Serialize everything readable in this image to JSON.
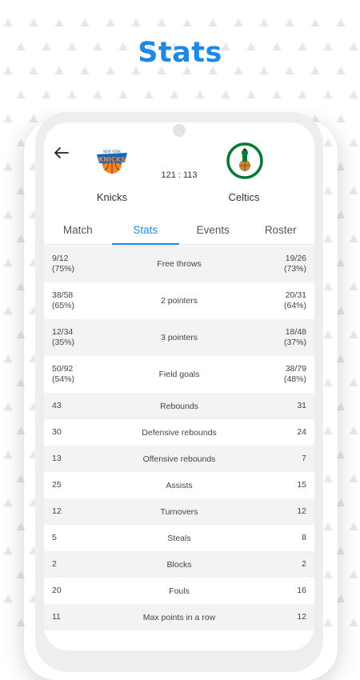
{
  "page": {
    "heading": "Stats"
  },
  "match": {
    "home": {
      "name": "Knicks",
      "logo_text": "NEW YORK KNICKS"
    },
    "away": {
      "name": "Celtics",
      "logo_text": "BOSTON CELTICS"
    },
    "score": "121 : 113"
  },
  "tabs": [
    {
      "label": "Match"
    },
    {
      "label": "Stats"
    },
    {
      "label": "Events"
    },
    {
      "label": "Roster"
    }
  ],
  "stats": [
    {
      "label": "Free throws",
      "home": "9/12",
      "home_pct": "(75%)",
      "away": "19/26",
      "away_pct": "(73%)"
    },
    {
      "label": "2 pointers",
      "home": "38/58",
      "home_pct": "(65%)",
      "away": "20/31",
      "away_pct": "(64%)"
    },
    {
      "label": "3 pointers",
      "home": "12/34",
      "home_pct": "(35%)",
      "away": "18/48",
      "away_pct": "(37%)"
    },
    {
      "label": "Field goals",
      "home": "50/92",
      "home_pct": "(54%)",
      "away": "38/79",
      "away_pct": "(48%)"
    },
    {
      "label": "Rebounds",
      "home": "43",
      "away": "31"
    },
    {
      "label": "Defensive rebounds",
      "home": "30",
      "away": "24"
    },
    {
      "label": "Offensive rebounds",
      "home": "13",
      "away": "7"
    },
    {
      "label": "Assists",
      "home": "25",
      "away": "15"
    },
    {
      "label": "Turnovers",
      "home": "12",
      "away": "12"
    },
    {
      "label": "Steals",
      "home": "5",
      "away": "8"
    },
    {
      "label": "Blocks",
      "home": "2",
      "away": "2"
    },
    {
      "label": "Fouls",
      "home": "20",
      "away": "16"
    },
    {
      "label": "Max points in a row",
      "home": "11",
      "away": "12"
    }
  ],
  "colors": {
    "accent": "#1e88e5",
    "row_alt": "#f3f3f3",
    "pattern": "#dfe9f6"
  },
  "icons": {
    "back": "arrow-left-icon"
  }
}
